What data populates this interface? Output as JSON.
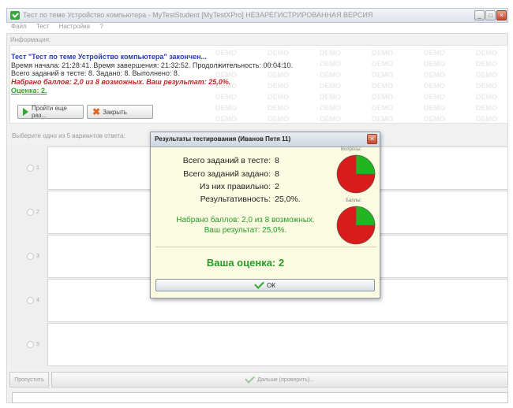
{
  "window": {
    "title": "Тест по теме Устройство компьютера - MyTestStudent [MyTestXPro] НЕЗАРЕГИСТРИРОВАННАЯ ВЕРСИЯ",
    "menu": [
      "Файл",
      "Тест",
      "Настройка",
      "?"
    ]
  },
  "info": {
    "label": "Информация:",
    "title": "Тест \"Тест по теме Устройство компьютера\" закончен...",
    "line1": "Время начала: 21:28:41. Время завершения: 21:32:52. Продолжительность: 00:04:10.",
    "line2": "Всего заданий в тесте: 8. Задано: 8. Выполнено: 8.",
    "score": "Набрано баллов: 2,0 из 8 возможных. Ваш результат: 25,0%.",
    "grade": "Оценка: 2.",
    "watermark": "DEMO",
    "retry_label": "Пройти еще раз...",
    "close_label": "Закрыть"
  },
  "answers": {
    "label": "Выберите одно из 5 вариантов ответа:",
    "numbers": [
      "1",
      "2",
      "3",
      "4",
      "5"
    ]
  },
  "bottom": {
    "skip_label": "Пропустить",
    "next_label": "Дальше (проверить)..."
  },
  "dialog": {
    "title": "Результаты тестирования (Иванов Петя 11)",
    "stats": [
      {
        "label": "Всего заданий в тесте:",
        "value": "8"
      },
      {
        "label": "Всего заданий задано:",
        "value": "8"
      },
      {
        "label": "Из них правильно:",
        "value": "2"
      },
      {
        "label": "Результативность:",
        "value": "25,0%."
      }
    ],
    "points_line1": "Набрано баллов: 2,0 из 8 возможных.",
    "points_line2": "Ваш результат: 25,0%.",
    "grade": "Ваша оценка: 2",
    "ok_label": "ОК",
    "pie1_label": "Вопросы:",
    "pie2_label": "Баллы:",
    "pie_correct_fraction": 0.25,
    "colors": {
      "correct": "#21b521",
      "wrong": "#d81c1c"
    }
  }
}
